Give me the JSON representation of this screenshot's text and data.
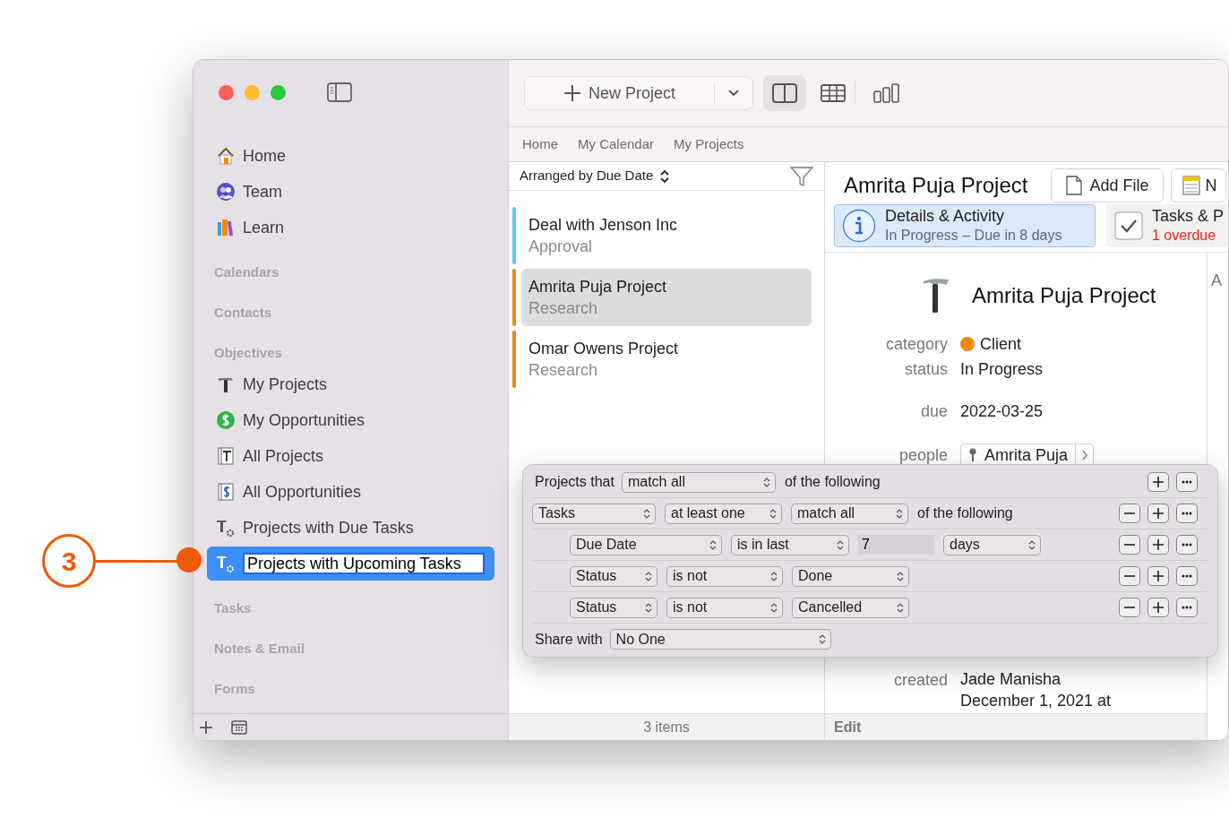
{
  "callout": {
    "number": "3"
  },
  "sidebar": {
    "entries": [
      {
        "kind": "home",
        "label": "Home",
        "selected": false
      },
      {
        "kind": "team",
        "label": "Team",
        "selected": false
      },
      {
        "kind": "learn",
        "label": "Learn",
        "selected": false
      },
      {
        "kind": "header",
        "label": "Calendars"
      },
      {
        "kind": "header",
        "label": "Contacts"
      },
      {
        "kind": "header",
        "label": "Objectives"
      },
      {
        "kind": "projects",
        "label": "My Projects",
        "selected": false
      },
      {
        "kind": "opportunities",
        "label": "My Opportunities",
        "selected": false
      },
      {
        "kind": "allprojects",
        "label": "All Projects",
        "selected": false
      },
      {
        "kind": "allopportunities",
        "label": "All Opportunities",
        "selected": false
      },
      {
        "kind": "smart",
        "label": "Projects with Due Tasks",
        "selected": false
      },
      {
        "kind": "smart",
        "label": "Projects with Upcoming Tasks",
        "selected": true
      },
      {
        "kind": "header",
        "label": "Tasks"
      },
      {
        "kind": "header",
        "label": "Notes & Email"
      },
      {
        "kind": "header",
        "label": "Forms"
      }
    ]
  },
  "toolbar": {
    "new_button": "New Project",
    "views": [
      {
        "kind": "split",
        "selected": true
      },
      {
        "kind": "table",
        "selected": false
      },
      {
        "kind": "columns",
        "selected": false
      }
    ]
  },
  "breadcrumbs": [
    "Home",
    "My Calendar",
    "My Projects"
  ],
  "list": {
    "sort_label": "Arranged by Due Date",
    "items": [
      {
        "title": "Deal with Jenson Inc",
        "subtitle": "Approval",
        "color": "#5ac8fa",
        "selected": false
      },
      {
        "title": "Amrita Puja Project",
        "subtitle": "Research",
        "color": "#f0870e",
        "selected": true
      },
      {
        "title": "Omar Owens Project",
        "subtitle": "Research",
        "color": "#f0870e",
        "selected": false
      }
    ],
    "status": "3 items"
  },
  "detail": {
    "title": "Amrita Puja Project",
    "buttons": [
      {
        "kind": "file",
        "label": "Add File"
      },
      {
        "kind": "note",
        "label": "N"
      }
    ],
    "tabs": [
      {
        "kind": "info",
        "title": "Details & Activity",
        "subtitle": "In Progress – Due in 8 days",
        "selected": true,
        "alert": false
      },
      {
        "kind": "check",
        "title": "Tasks & P",
        "subtitle": "1 overdue",
        "selected": false,
        "alert": true
      }
    ],
    "heading": "Amrita Puja Project",
    "fields": [
      {
        "label": "category",
        "value": "Client",
        "color": "#f0880c"
      },
      {
        "label": "status",
        "value": "In Progress"
      },
      {
        "label": "due",
        "value": "2022-03-25"
      },
      {
        "label": "people",
        "value": "Amrita Puja"
      },
      {
        "label": "created",
        "value": "Jade Manisha",
        "extra": "December 1, 2021 at"
      }
    ],
    "status": "Edit"
  },
  "column_3": {
    "text": "A"
  },
  "filter": {
    "rows": [
      {
        "kind": "head",
        "controls": [
          {
            "kind": "text",
            "value": "Projects that"
          },
          {
            "kind": "popup",
            "value": "match all"
          },
          {
            "kind": "text",
            "value": "of the following"
          }
        ],
        "buttons": [
          {
            "kind": "plus"
          },
          {
            "kind": "more"
          }
        ]
      },
      {
        "kind": "group",
        "controls": [
          {
            "kind": "popup",
            "value": "Tasks"
          },
          {
            "kind": "popup",
            "value": "at least one"
          },
          {
            "kind": "popup",
            "value": "match all"
          },
          {
            "kind": "text",
            "value": "of the following"
          }
        ],
        "buttons": [
          {
            "kind": "minus"
          },
          {
            "kind": "plus"
          },
          {
            "kind": "more"
          }
        ]
      },
      {
        "kind": "condition",
        "controls": [
          {
            "kind": "popup",
            "value": "Due Date"
          },
          {
            "kind": "popup",
            "value": "is in last"
          },
          {
            "kind": "field",
            "value": "7"
          },
          {
            "kind": "popup",
            "value": "days"
          }
        ],
        "buttons": [
          {
            "kind": "minus"
          },
          {
            "kind": "plus"
          },
          {
            "kind": "more"
          }
        ]
      },
      {
        "kind": "condition",
        "controls": [
          {
            "kind": "popup",
            "value": "Status"
          },
          {
            "kind": "popup",
            "value": "is not"
          },
          {
            "kind": "popup",
            "value": "Done"
          }
        ],
        "buttons": [
          {
            "kind": "minus"
          },
          {
            "kind": "plus"
          },
          {
            "kind": "more"
          }
        ]
      },
      {
        "kind": "condition",
        "controls": [
          {
            "kind": "popup",
            "value": "Status"
          },
          {
            "kind": "popup",
            "value": "is not"
          },
          {
            "kind": "popup",
            "value": "Cancelled"
          }
        ],
        "buttons": [
          {
            "kind": "minus"
          },
          {
            "kind": "plus"
          },
          {
            "kind": "more"
          }
        ]
      },
      {
        "kind": "share",
        "controls": [
          {
            "kind": "text",
            "value": "Share with"
          },
          {
            "kind": "popup",
            "value": "No One"
          }
        ],
        "buttons": []
      }
    ]
  }
}
